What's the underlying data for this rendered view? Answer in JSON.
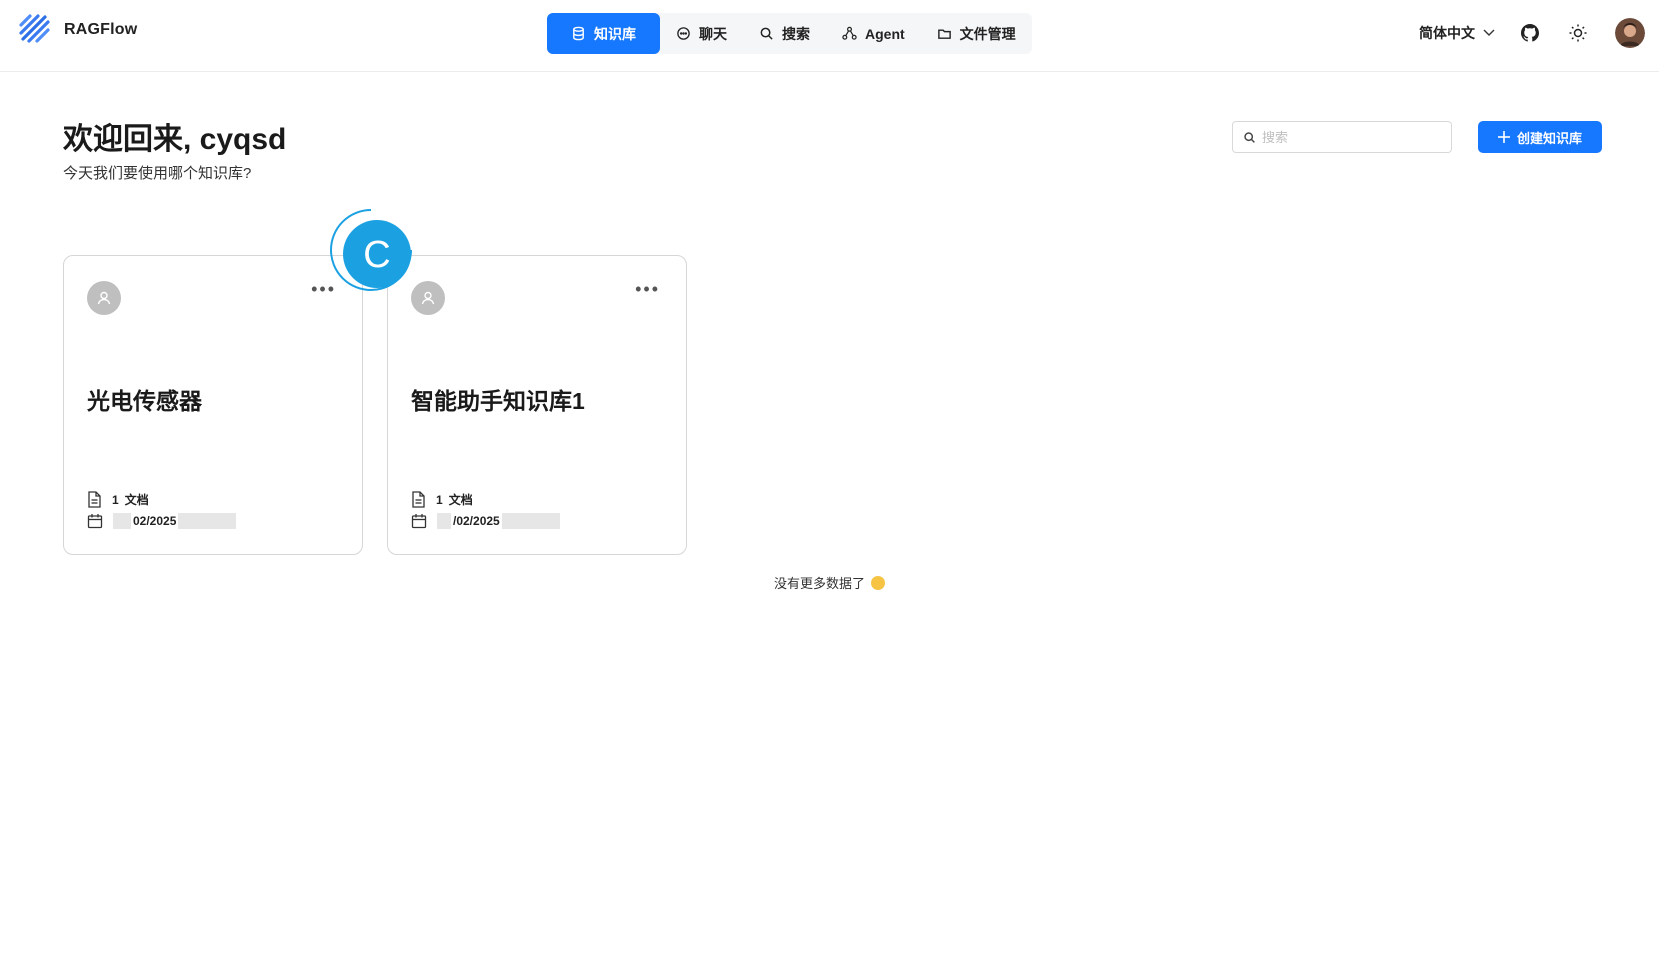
{
  "header": {
    "app_name": "RAGFlow",
    "nav": [
      {
        "label": "知识库",
        "icon": "database-icon",
        "active": true
      },
      {
        "label": "聊天",
        "icon": "chat-icon",
        "active": false
      },
      {
        "label": "搜索",
        "icon": "search-icon",
        "active": false
      },
      {
        "label": "Agent",
        "icon": "agent-graph-icon",
        "active": false
      },
      {
        "label": "文件管理",
        "icon": "folder-icon",
        "active": false
      }
    ],
    "language": "简体中文"
  },
  "welcome": {
    "title": "欢迎回来, cyqsd",
    "subtitle": "今天我们要使用哪个知识库?"
  },
  "search": {
    "placeholder": "搜索",
    "value": ""
  },
  "create_button": {
    "label": "创建知识库"
  },
  "loading_badge": {
    "letter": "C"
  },
  "cards": [
    {
      "title": "光电传感器",
      "doc_count": "1",
      "doc_label": "文档",
      "date": "02/2025"
    },
    {
      "title": "智能助手知识库1",
      "doc_count": "1",
      "doc_label": "文档",
      "date": "/02/2025"
    }
  ],
  "footer": {
    "no_more": "没有更多数据了"
  },
  "colors": {
    "accent": "#1677ff",
    "loading": "#1ba1e2"
  }
}
